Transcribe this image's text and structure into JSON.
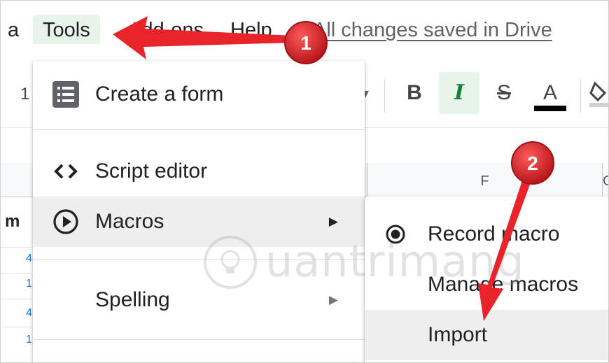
{
  "menubar": {
    "items": [
      "a",
      "Tools",
      "Add-ons",
      "Help"
    ],
    "save_status": "All changes saved in Drive"
  },
  "toolbar": {
    "zoom_partial": "1",
    "bold": "B",
    "italic": "I",
    "strikethrough": "S",
    "text_color": "A"
  },
  "grid": {
    "columns": [
      "F",
      "G"
    ],
    "row_header_partial": "m",
    "row_values_partial": [
      "4",
      "1",
      "4",
      "1"
    ]
  },
  "tools_menu": {
    "items": [
      {
        "label": "Create a form",
        "icon": "form-icon",
        "has_submenu": false
      },
      {
        "label": "Script editor",
        "icon": "code-icon",
        "has_submenu": false
      },
      {
        "label": "Macros",
        "icon": "play-circle-icon",
        "has_submenu": true
      },
      {
        "label": "Spelling",
        "icon": "",
        "has_submenu": true
      }
    ],
    "submenu_arrow": "▶"
  },
  "macros_submenu": {
    "items": [
      {
        "label": "Record macro",
        "icon": "radio-record-icon"
      },
      {
        "label": "Manage macros",
        "icon": ""
      },
      {
        "label": "Import",
        "icon": ""
      }
    ]
  },
  "annotations": {
    "steps": [
      "1",
      "2"
    ],
    "marker_color": "#d62128",
    "arrow_color": "#e8232a"
  },
  "watermark": {
    "text": "uantrimang"
  },
  "colors": {
    "highlight_green": "#e6f4ea",
    "italic_green": "#188038",
    "hover_gray": "#eeeeee"
  }
}
